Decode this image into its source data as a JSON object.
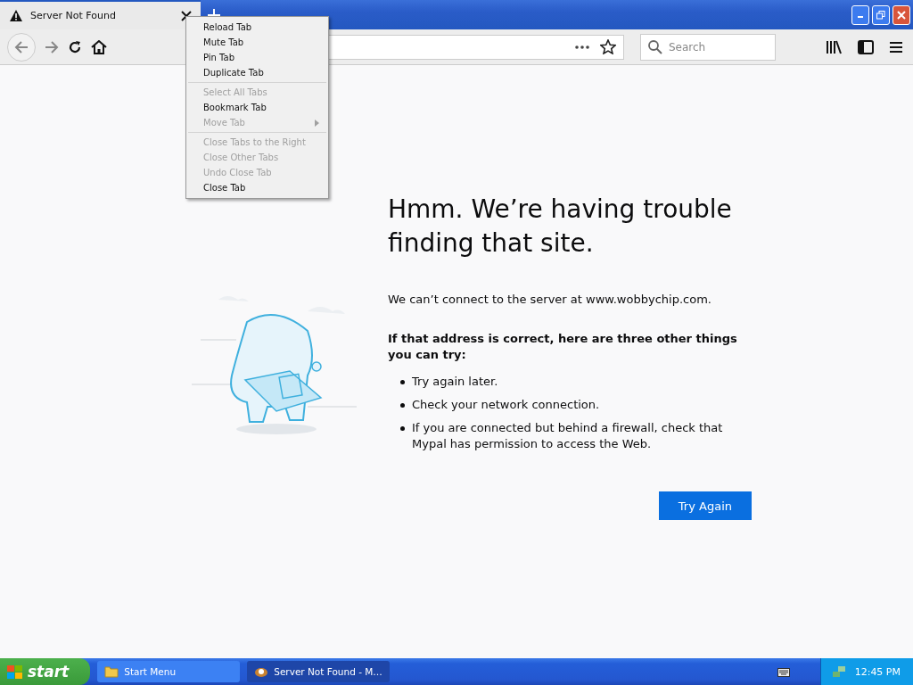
{
  "tab": {
    "title": "Server Not Found"
  },
  "toolbar": {
    "search": {
      "placeholder": "Search"
    }
  },
  "context_menu": {
    "sections": [
      [
        {
          "label": "Reload Tab",
          "disabled": false
        },
        {
          "label": "Mute Tab",
          "disabled": false
        },
        {
          "label": "Pin Tab",
          "disabled": false
        },
        {
          "label": "Duplicate Tab",
          "disabled": false
        }
      ],
      [
        {
          "label": "Select All Tabs",
          "disabled": true
        },
        {
          "label": "Bookmark Tab",
          "disabled": false
        },
        {
          "label": "Move Tab",
          "disabled": true,
          "submenu": true
        }
      ],
      [
        {
          "label": "Close Tabs to the Right",
          "disabled": true
        },
        {
          "label": "Close Other Tabs",
          "disabled": true
        },
        {
          "label": "Undo Close Tab",
          "disabled": true
        },
        {
          "label": "Close Tab",
          "disabled": false
        }
      ]
    ]
  },
  "error_page": {
    "title": "Hmm. We’re having trouble finding that site.",
    "description": "We can’t connect to the server at www.wobbychip.com.",
    "subtitle": "If that address is correct, here are three other things you can try:",
    "tips": [
      "Try again later.",
      "Check your network connection.",
      "If you are connected but behind a firewall, check that Mypal has permission to access the Web."
    ],
    "button": "Try Again"
  },
  "taskbar": {
    "start": "start",
    "tasks": [
      {
        "label": "Start Menu",
        "selected": false
      },
      {
        "label": "Server Not Found - M…",
        "selected": true
      }
    ],
    "clock": "12:45 PM"
  }
}
